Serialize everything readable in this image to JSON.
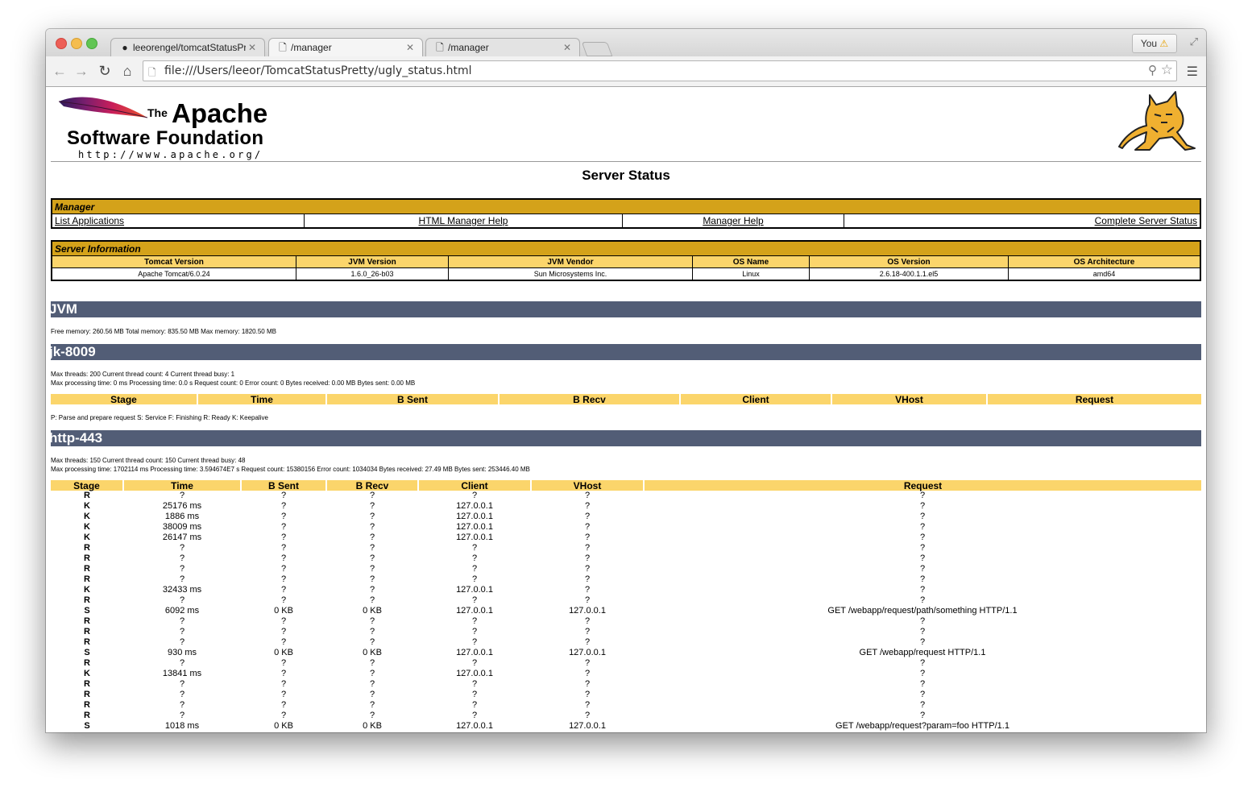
{
  "browser": {
    "tabs": [
      {
        "title": "leeorengel/tomcatStatusPr",
        "icon": "github-icon",
        "active": false
      },
      {
        "title": "/manager",
        "icon": "page-icon",
        "active": true
      },
      {
        "title": "/manager",
        "icon": "page-icon",
        "active": false
      }
    ],
    "profile_label": "You",
    "url": "file:///Users/leeor/TomcatStatusPretty/ugly_status.html"
  },
  "header": {
    "logo_the": "The",
    "logo_apache": "Apache",
    "logo_foundation": "Software Foundation",
    "logo_url": "http://www.apache.org/",
    "title": "Server Status"
  },
  "manager": {
    "heading": "Manager",
    "links": [
      "List Applications",
      "HTML Manager Help",
      "Manager Help",
      "Complete Server Status"
    ]
  },
  "server_info": {
    "heading": "Server Information",
    "columns": [
      "Tomcat Version",
      "JVM Version",
      "JVM Vendor",
      "OS Name",
      "OS Version",
      "OS Architecture"
    ],
    "values": [
      "Apache Tomcat/6.0.24",
      "1.6.0_26-b03",
      "Sun Microsystems Inc.",
      "Linux",
      "2.6.18-400.1.1.el5",
      "amd64"
    ]
  },
  "jvm": {
    "heading": "JVM",
    "memory": "Free memory: 260.56 MB Total memory: 835.50 MB Max memory: 1820.50 MB"
  },
  "jk": {
    "heading": "jk-8009",
    "threads": "Max threads: 200 Current thread count: 4 Current thread busy: 1",
    "processing": "Max processing time: 0 ms Processing time: 0.0 s Request count: 0 Error count: 0 Bytes received: 0.00 MB Bytes sent: 0.00 MB",
    "columns": [
      "Stage",
      "Time",
      "B Sent",
      "B Recv",
      "Client",
      "VHost",
      "Request"
    ],
    "legend": "P: Parse and prepare request S: Service F: Finishing R: Ready K: Keepalive"
  },
  "http": {
    "heading": "http-443",
    "threads": "Max threads: 150 Current thread count: 150 Current thread busy: 48",
    "processing": "Max processing time: 1702114 ms Processing time: 3.594674E7 s Request count: 15380156 Error count: 1034034 Bytes received: 27.49 MB Bytes sent: 253446.40 MB",
    "columns": [
      "Stage",
      "Time",
      "B Sent",
      "B Recv",
      "Client",
      "VHost",
      "Request"
    ],
    "rows": [
      [
        "R",
        "?",
        "?",
        "?",
        "?",
        "?",
        "?"
      ],
      [
        "K",
        "25176 ms",
        "?",
        "?",
        "127.0.0.1",
        "?",
        "?"
      ],
      [
        "K",
        "1886 ms",
        "?",
        "?",
        "127.0.0.1",
        "?",
        "?"
      ],
      [
        "K",
        "38009 ms",
        "?",
        "?",
        "127.0.0.1",
        "?",
        "?"
      ],
      [
        "K",
        "26147 ms",
        "?",
        "?",
        "127.0.0.1",
        "?",
        "?"
      ],
      [
        "R",
        "?",
        "?",
        "?",
        "?",
        "?",
        "?"
      ],
      [
        "R",
        "?",
        "?",
        "?",
        "?",
        "?",
        "?"
      ],
      [
        "R",
        "?",
        "?",
        "?",
        "?",
        "?",
        "?"
      ],
      [
        "R",
        "?",
        "?",
        "?",
        "?",
        "?",
        "?"
      ],
      [
        "K",
        "32433 ms",
        "?",
        "?",
        "127.0.0.1",
        "?",
        "?"
      ],
      [
        "R",
        "?",
        "?",
        "?",
        "?",
        "?",
        "?"
      ],
      [
        "S",
        "6092 ms",
        "0 KB",
        "0 KB",
        "127.0.0.1",
        "127.0.0.1",
        "GET /webapp/request/path/something HTTP/1.1"
      ],
      [
        "R",
        "?",
        "?",
        "?",
        "?",
        "?",
        "?"
      ],
      [
        "R",
        "?",
        "?",
        "?",
        "?",
        "?",
        "?"
      ],
      [
        "R",
        "?",
        "?",
        "?",
        "?",
        "?",
        "?"
      ],
      [
        "S",
        "930 ms",
        "0 KB",
        "0 KB",
        "127.0.0.1",
        "127.0.0.1",
        "GET /webapp/request HTTP/1.1"
      ],
      [
        "R",
        "?",
        "?",
        "?",
        "?",
        "?",
        "?"
      ],
      [
        "K",
        "13841 ms",
        "?",
        "?",
        "127.0.0.1",
        "?",
        "?"
      ],
      [
        "R",
        "?",
        "?",
        "?",
        "?",
        "?",
        "?"
      ],
      [
        "R",
        "?",
        "?",
        "?",
        "?",
        "?",
        "?"
      ],
      [
        "R",
        "?",
        "?",
        "?",
        "?",
        "?",
        "?"
      ],
      [
        "R",
        "?",
        "?",
        "?",
        "?",
        "?",
        "?"
      ],
      [
        "S",
        "1018 ms",
        "0 KB",
        "0 KB",
        "127.0.0.1",
        "127.0.0.1",
        "GET /webapp/request?param=foo HTTP/1.1"
      ]
    ]
  }
}
